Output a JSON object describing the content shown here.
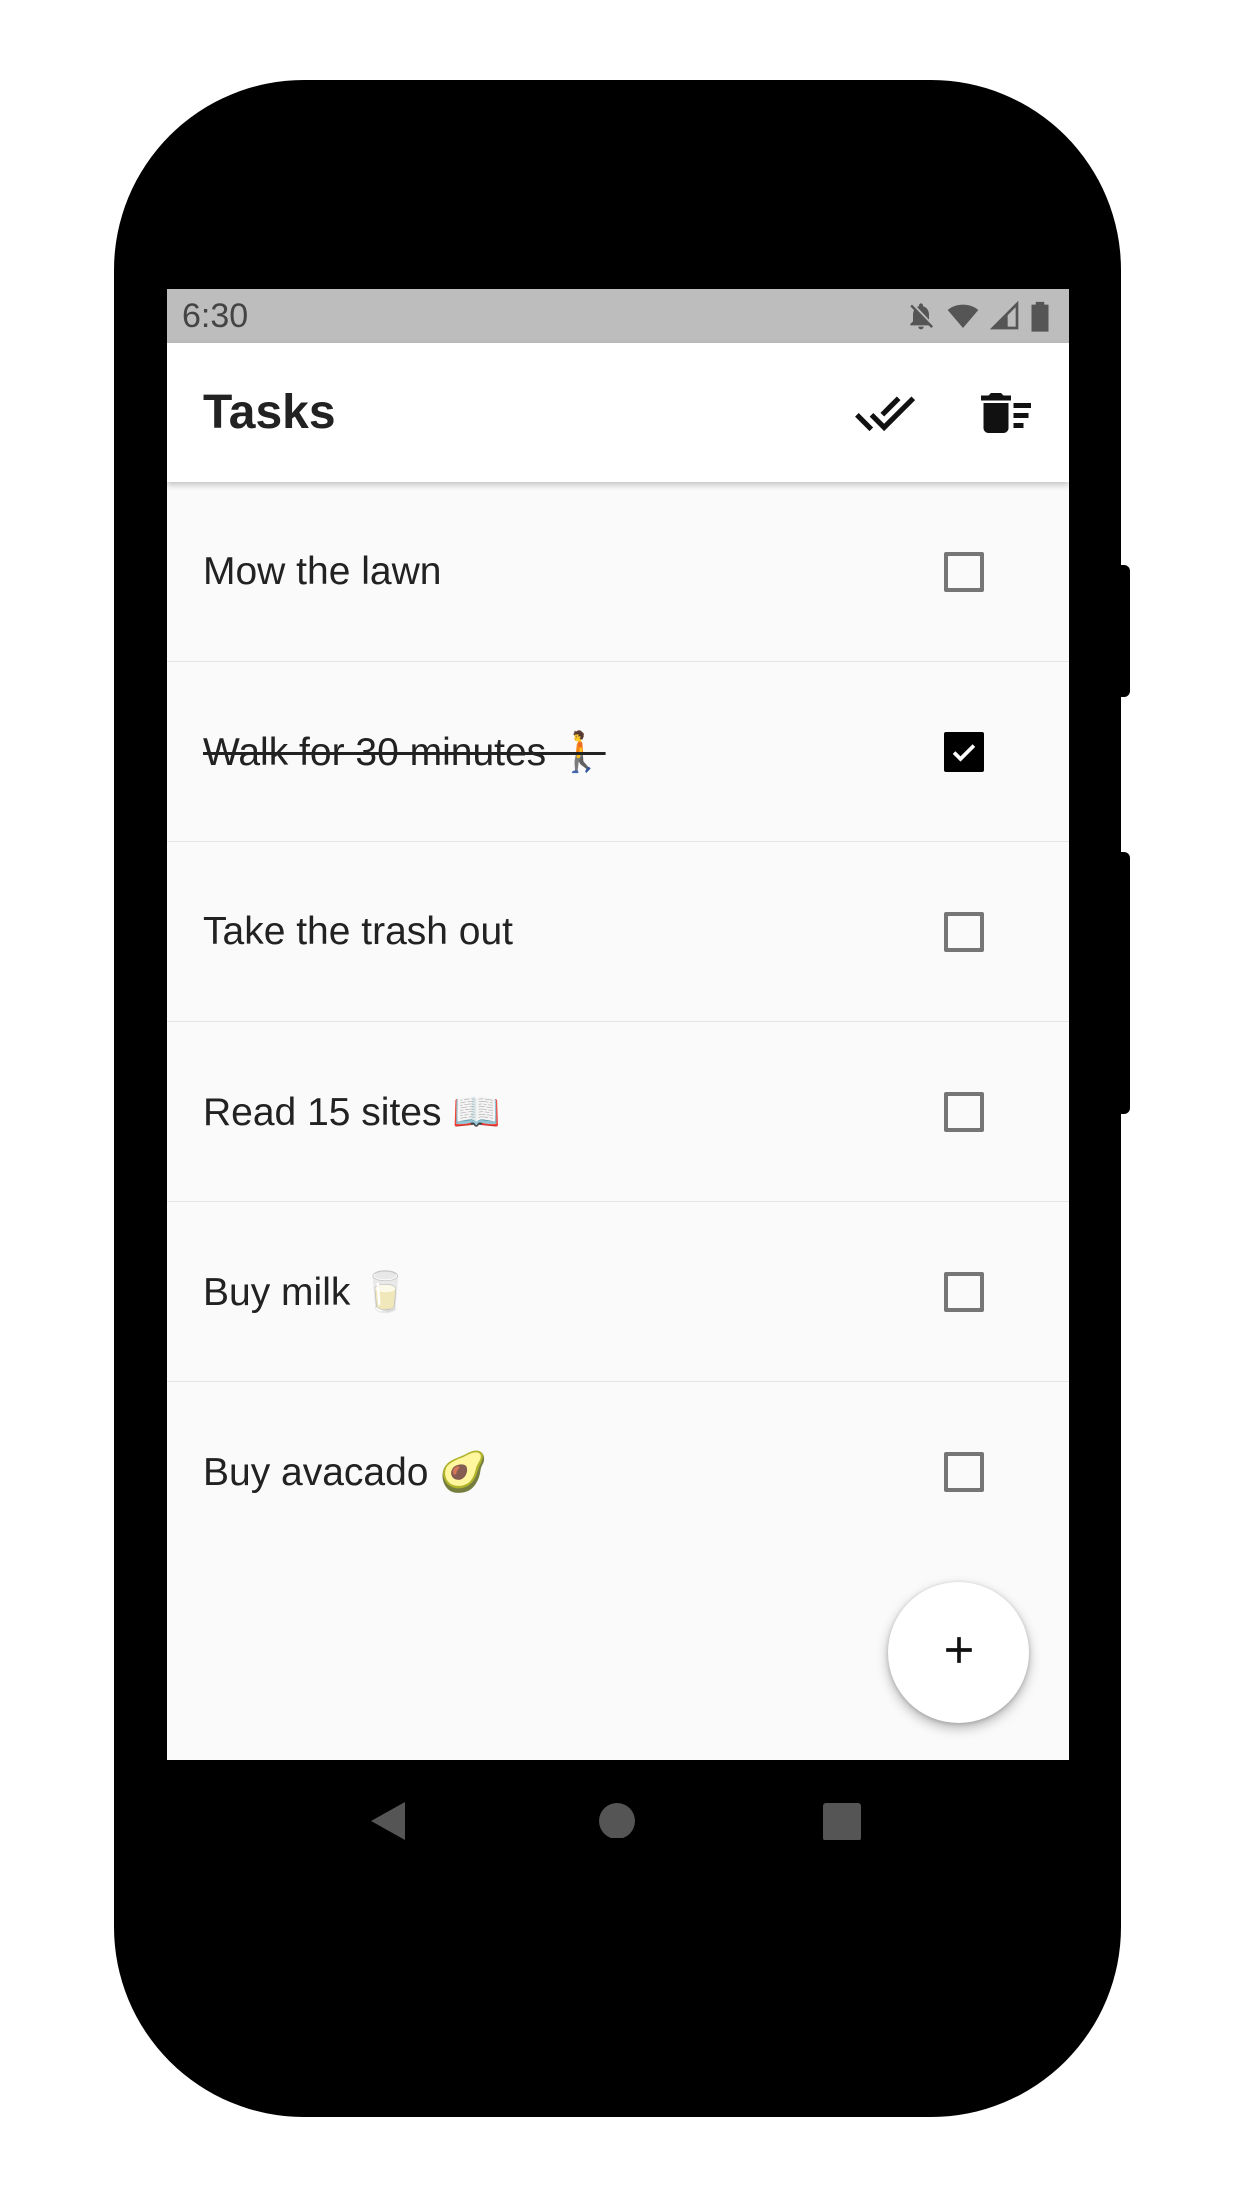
{
  "status_bar": {
    "time": "6:30",
    "icons": [
      "notifications-off-icon",
      "wifi-icon",
      "signal-icon",
      "battery-icon"
    ]
  },
  "app_bar": {
    "title": "Tasks",
    "actions": [
      {
        "icon": "done-all-icon"
      },
      {
        "icon": "delete-sweep-icon"
      }
    ]
  },
  "tasks": [
    {
      "label": "Mow the lawn",
      "done": false
    },
    {
      "label": "Walk for 30 minutes 🚶",
      "done": true
    },
    {
      "label": "Take the trash out",
      "done": false
    },
    {
      "label": "Read 15 sites 📖",
      "done": false
    },
    {
      "label": "Buy milk 🥛",
      "done": false
    },
    {
      "label": "Buy avacado 🥑",
      "done": false
    }
  ],
  "fab": {
    "icon": "add-icon"
  },
  "nav_bar": {
    "buttons": [
      "back-icon",
      "home-icon",
      "recents-icon"
    ]
  }
}
